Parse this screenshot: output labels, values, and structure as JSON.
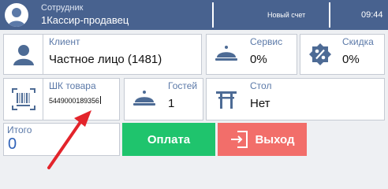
{
  "header": {
    "role_label": "Сотрудник",
    "user_name": "1Кассир-продавец",
    "receipt_label": "Новый счет",
    "time": "09:44"
  },
  "client": {
    "label": "Клиент",
    "value": "Частное лицо (1481)"
  },
  "service": {
    "label": "Сервис",
    "value": "0%"
  },
  "discount": {
    "label": "Скидка",
    "value": "0%"
  },
  "barcode": {
    "label": "ШК товара",
    "value": "5449000189356"
  },
  "guests": {
    "label": "Гостей",
    "value": "1"
  },
  "table": {
    "label": "Стол",
    "value": "Нет"
  },
  "total": {
    "label": "Итого",
    "value": "0"
  },
  "buttons": {
    "pay": "Оплата",
    "exit": "Выход"
  },
  "colors": {
    "header": "#48628f",
    "accent": "#5b79a8",
    "pay": "#1fc46d",
    "exit": "#f26e6a",
    "annotation_arrow": "#e3242b"
  },
  "icons": {
    "avatar": "user-avatar-icon",
    "client": "person-icon",
    "service": "serving-dish-icon",
    "discount": "percent-badge-icon",
    "barcode": "barcode-icon",
    "guests": "serving-dish-icon",
    "table": "torii-table-icon",
    "exit": "exit-door-icon"
  }
}
